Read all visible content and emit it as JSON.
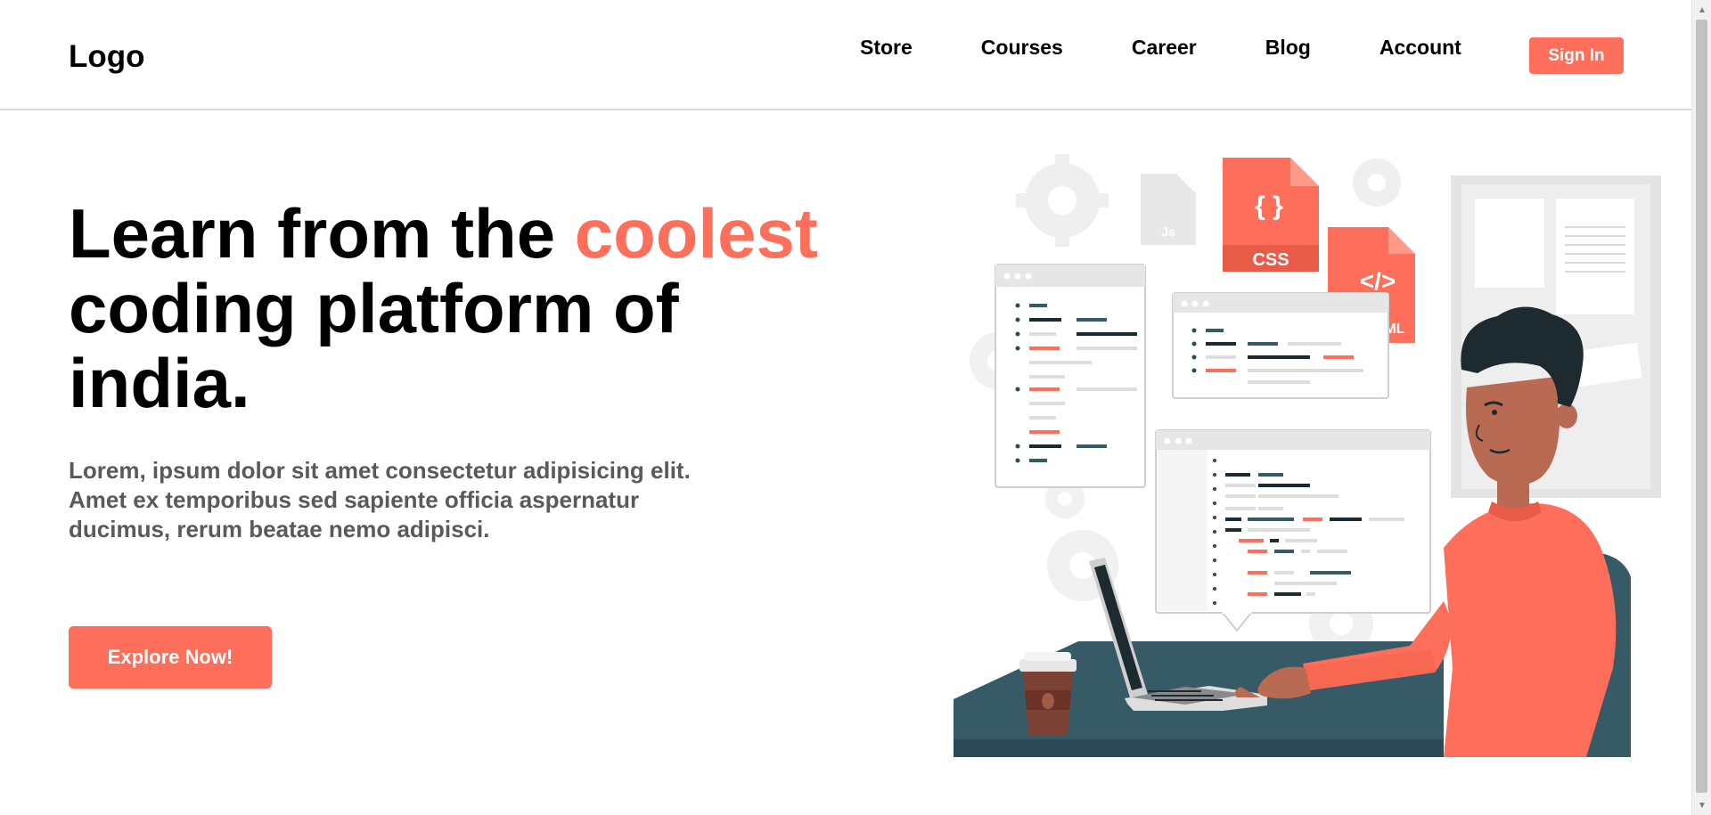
{
  "navbar": {
    "logo": "Logo",
    "links": [
      "Store",
      "Courses",
      "Career",
      "Blog",
      "Account"
    ],
    "signin_label": "Sign In"
  },
  "hero": {
    "title_part1": "Learn from the ",
    "title_accent": "coolest",
    "title_part2": " coding platform of india.",
    "description": "Lorem, ipsum dolor sit amet consectetur adipisicing elit. Amet ex temporibus sed sapiente officia aspernatur ducimus, rerum beatae nemo adipisci.",
    "cta_label": "Explore Now!"
  },
  "illustration": {
    "file_labels": {
      "css": "CSS",
      "css_symbol": "{ }",
      "html": "ML",
      "html_symbol": "</>",
      "js": "Js"
    }
  },
  "colors": {
    "accent": "#fd6f5a",
    "dark_teal": "#365a66",
    "text_gray": "#5a5a5a"
  }
}
